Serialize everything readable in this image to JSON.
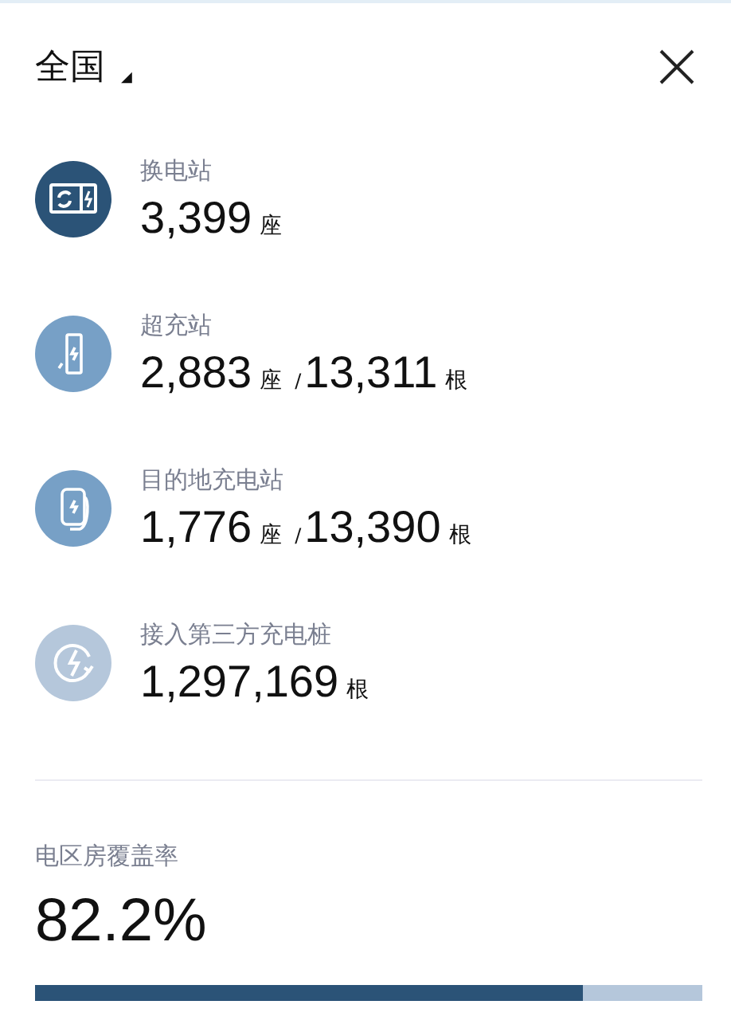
{
  "header": {
    "region": "全国",
    "dropdown_caret": "◢"
  },
  "stations": [
    {
      "kind": "swap",
      "color": "#2b5377",
      "label": "换电站",
      "count": "3,399",
      "unit": "座"
    },
    {
      "kind": "supercharge",
      "color": "#77a0c6",
      "label": "超充站",
      "count": "2,883",
      "unit": "座",
      "separator": "/",
      "count2": "13,311",
      "unit2": "根"
    },
    {
      "kind": "destination",
      "color": "#77a0c6",
      "label": "目的地充电站",
      "count": "1,776",
      "unit": "座",
      "separator": "/",
      "count2": "13,390",
      "unit2": "根"
    },
    {
      "kind": "third_party",
      "color": "#b5c7db",
      "label": "接入第三方充电桩",
      "count": "1,297,169",
      "unit": "根"
    }
  ],
  "coverage": {
    "label": "电区房覆盖率",
    "value": "82.2%",
    "level": 0.822
  }
}
